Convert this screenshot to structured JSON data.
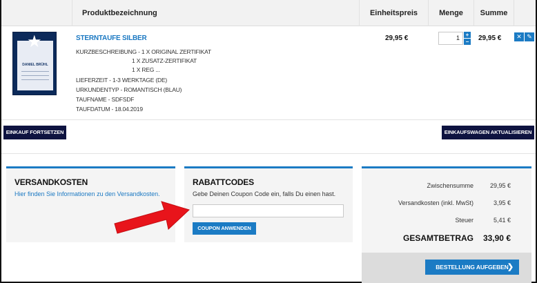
{
  "header": {
    "name": "Produktbezeichnung",
    "unit_price": "Einheitspreis",
    "quantity": "Menge",
    "sum": "Summe"
  },
  "item": {
    "thumb_text": "DANIEL BRÜHL",
    "name": "STERNTAUFE SILBER",
    "attrs": [
      "KURZBESCHREIBUNG - 1 X ORIGINAL ZERTIFIKAT",
      "1 X ZUSATZ-ZERTIFIKAT",
      "1 X REG   ...",
      "LIEFERZEIT - 1-3 WERKTAGE (DE)",
      "URKUNDENTYP - ROMANTISCH (BLAU)",
      "TAUFNAME - SDFSDF",
      "TAUFDATUM - 18.04.2019"
    ],
    "price": "29,95 €",
    "quantity": "1",
    "sum": "29,95 €"
  },
  "icons": {
    "plus": "+",
    "minus": "−",
    "remove": "✕",
    "edit": "✎"
  },
  "buttons": {
    "continue": "EINKAUF FORTSETZEN",
    "update": "EINKAUFSWAGEN AKTUALISIEREN",
    "coupon": "COUPON ANWENDEN",
    "order": "BESTELLUNG AUFGEBEN",
    "order_chevron": "❯"
  },
  "shipping": {
    "title": "VERSANDKOSTEN",
    "info": "Hier finden Sie Informationen zu den Versandkosten."
  },
  "coupon": {
    "title": "RABATTCODES",
    "info": "Gebe Deinen Coupon Code ein, falls Du einen hast.",
    "value": ""
  },
  "totals": {
    "subtotal_label": "Zwischensumme",
    "subtotal": "29,95 €",
    "shipping_label": "Versandkosten (inkl. MwSt)",
    "shipping": "3,95 €",
    "tax_label": "Steuer",
    "tax": "5,41 €",
    "grand_label": "GESAMTBETRAG",
    "grand": "33,90 €"
  },
  "colors": {
    "accent": "#1b7bc4",
    "dark_button": "#0e1340",
    "arrow": "#e8141b"
  }
}
